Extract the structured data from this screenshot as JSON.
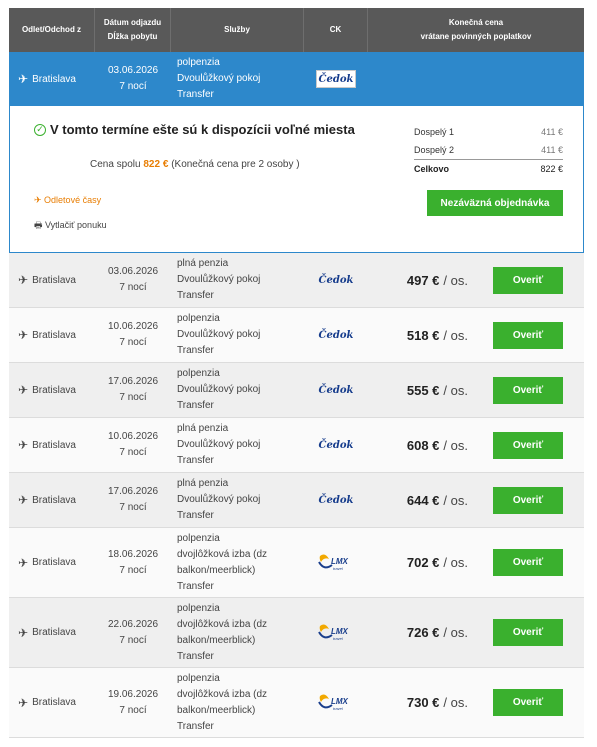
{
  "header": {
    "from": "Odlet/Odchod z",
    "date_line1": "Dátum odjazdu",
    "date_line2": "Dĺžka pobytu",
    "services": "Služby",
    "ck": "CK",
    "price_line1": "Konečná cena",
    "price_line2": "vrátane povinných poplatkov"
  },
  "selected": {
    "from": "Bratislava",
    "date": "03.06.2026",
    "nights": "7 nocí",
    "board": "polpenzia",
    "room": "Dvoulůžkový pokoj",
    "transfer": "Transfer",
    "operator": "Čedok"
  },
  "detail": {
    "availability": "V tomto termíne ešte sú k dispozícii voľné miesta",
    "total_prefix": "Cena spolu",
    "total_value": "822 €",
    "total_suffix": "(Konečná cena pre 2 osoby )",
    "flight_times": "Odletové časy",
    "print": "Vytlačiť ponuku",
    "prices": [
      {
        "label": "Dospelý 1",
        "value": "411 €"
      },
      {
        "label": "Dospelý 2",
        "value": "411 €"
      },
      {
        "label": "Celkovo",
        "value": "822 €"
      }
    ],
    "order_button": "Nezáväzná objednávka"
  },
  "rows": [
    {
      "from": "Bratislava",
      "date": "03.06.2026",
      "nights": "7 nocí",
      "s1": "plná penzia",
      "s2": "Dvoulůžkový pokoj",
      "s3": "Transfer",
      "operator": "Čedok",
      "price": "497 €",
      "unit": "/ os.",
      "button": "Overiť"
    },
    {
      "from": "Bratislava",
      "date": "10.06.2026",
      "nights": "7 nocí",
      "s1": "polpenzia",
      "s2": "Dvoulůžkový pokoj",
      "s3": "Transfer",
      "operator": "Čedok",
      "price": "518 €",
      "unit": "/ os.",
      "button": "Overiť"
    },
    {
      "from": "Bratislava",
      "date": "17.06.2026",
      "nights": "7 nocí",
      "s1": "polpenzia",
      "s2": "Dvoulůžkový pokoj",
      "s3": "Transfer",
      "operator": "Čedok",
      "price": "555 €",
      "unit": "/ os.",
      "button": "Overiť"
    },
    {
      "from": "Bratislava",
      "date": "10.06.2026",
      "nights": "7 nocí",
      "s1": "plná penzia",
      "s2": "Dvoulůžkový pokoj",
      "s3": "Transfer",
      "operator": "Čedok",
      "price": "608 €",
      "unit": "/ os.",
      "button": "Overiť"
    },
    {
      "from": "Bratislava",
      "date": "17.06.2026",
      "nights": "7 nocí",
      "s1": "plná penzia",
      "s2": "Dvoulůžkový pokoj",
      "s3": "Transfer",
      "operator": "Čedok",
      "price": "644 €",
      "unit": "/ os.",
      "button": "Overiť"
    },
    {
      "from": "Bratislava",
      "date": "18.06.2026",
      "nights": "7 nocí",
      "s1": "polpenzia",
      "s2": "dvojlôžková izba (dz",
      "s2b": "balkon/meerblick)",
      "s3": "Transfer",
      "operator": "LMX",
      "price": "702 €",
      "unit": "/ os.",
      "button": "Overiť"
    },
    {
      "from": "Bratislava",
      "date": "22.06.2026",
      "nights": "7 nocí",
      "s1": "polpenzia",
      "s2": "dvojlôžková izba (dz",
      "s2b": "balkon/meerblick)",
      "s3": "Transfer",
      "operator": "LMX",
      "price": "726 €",
      "unit": "/ os.",
      "button": "Overiť"
    },
    {
      "from": "Bratislava",
      "date": "19.06.2026",
      "nights": "7 nocí",
      "s1": "polpenzia",
      "s2": "dvojlôžková izba (dz",
      "s2b": "balkon/meerblick)",
      "s3": "Transfer",
      "operator": "LMX",
      "price": "730 €",
      "unit": "/ os.",
      "button": "Overiť"
    }
  ],
  "logos": {
    "lmx_sub": "travel"
  }
}
